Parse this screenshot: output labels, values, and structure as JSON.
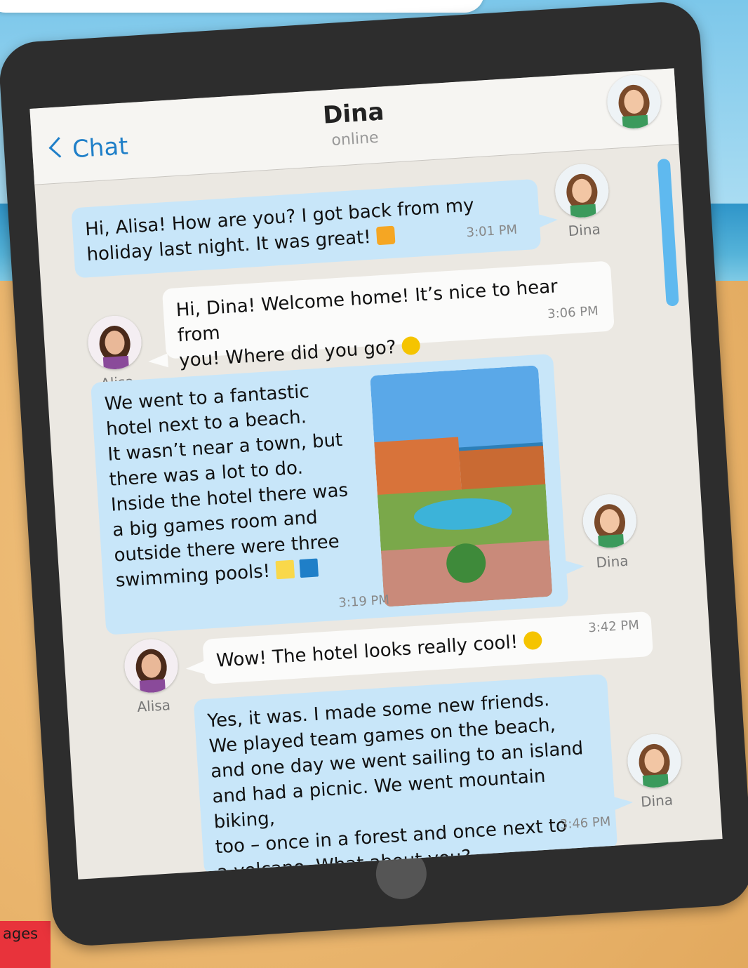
{
  "header": {
    "back_label": "Chat",
    "contact_name": "Dina",
    "contact_status": "online"
  },
  "messages": [
    {
      "sender": "Dina",
      "direction": "in",
      "text": "Hi, Alisa! How are you? I got back from my\nholiday last night. It was great!",
      "emoji": "thumbs-up-icon",
      "time": "3:01 PM"
    },
    {
      "sender": "Alisa",
      "direction": "out",
      "text": "Hi, Dina! Welcome home! It’s nice to hear from\nyou! Where did you go?",
      "emoji": "smile-icon",
      "time": "3:06 PM"
    },
    {
      "sender": "Dina",
      "direction": "in",
      "text": "We went to a fantastic\nhotel next to a beach.\nIt wasn’t near a town, but\nthere was a lot to do.\nInside the hotel there was\na big games room and\noutside there were three\nswimming pools!",
      "emoji": "sun-icon swimmer-icon",
      "time": "3:19 PM",
      "image": "hotel-photo"
    },
    {
      "sender": "Alisa",
      "direction": "out",
      "text": "Wow! The hotel looks really cool!",
      "emoji": "sunglasses-icon",
      "time": "3:42 PM"
    },
    {
      "sender": "Dina",
      "direction": "in",
      "text": "Yes, it was. I made some new friends.\nWe played team games on the beach,\nand one day we went sailing to an island\nand had a picnic. We went mountain biking,\ntoo – once in a forest and once next to\na volcano. What about you?",
      "time": "3:46 PM"
    }
  ],
  "labels": {
    "dina": "Dina",
    "alisa": "Alisa"
  },
  "page_tab": "ages",
  "colors": {
    "incoming_bubble": "#c8e6f9",
    "outgoing_bubble": "#fbfbfa",
    "accent": "#1f7fc8",
    "tablet": "#2d2d2d"
  }
}
